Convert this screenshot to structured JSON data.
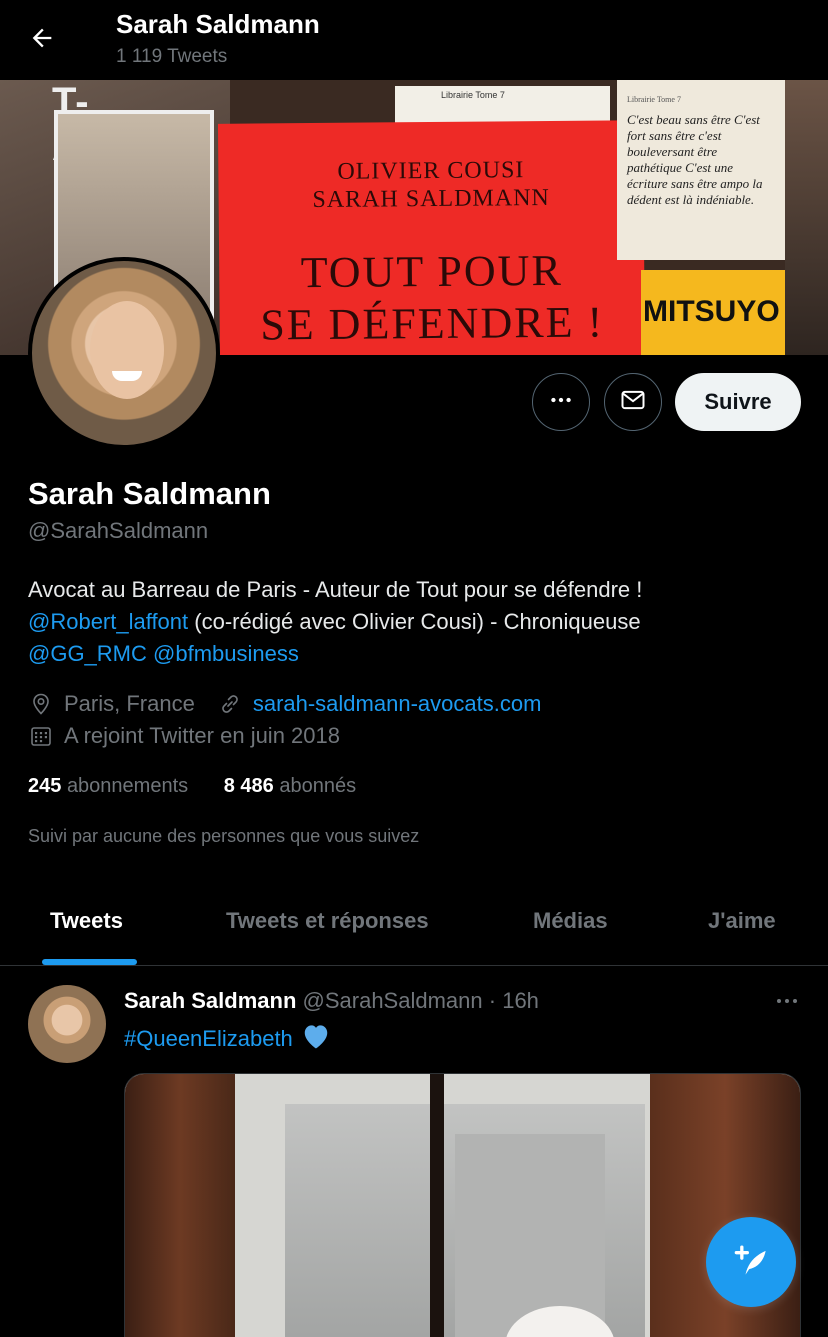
{
  "header": {
    "title": "Sarah Saldmann",
    "subtitle": "1 119 Tweets",
    "back_icon": "back-arrow-icon"
  },
  "banner": {
    "left_text": "T-ANDRÉ",
    "book_author_1": "OLIVIER COUSI",
    "book_author_2": "SARAH SALDMANN",
    "book_title_1": "TOUT POUR",
    "book_title_2": "SE DÉFENDRE !",
    "note_small": "Librairie Tome 7",
    "note_header": "Librairie Tome 7",
    "note_lines": "C'est beau sans être C'est fort sans être c'est bouleversant être pathétique C'est une écriture sans être ampo la dédent est là indéniable.",
    "yellow_label": "MITSUYO"
  },
  "actions": {
    "more_icon": "more-horizontal-icon",
    "mail_icon": "envelope-icon",
    "follow_label": "Suivre"
  },
  "profile": {
    "name": "Sarah Saldmann",
    "handle": "@SarahSaldmann",
    "bio_line1": "Avocat au Barreau de Paris - Auteur de Tout pour se défendre !",
    "bio_mention1": "@Robert_laffont",
    "bio_line2_rest": " (co-rédigé avec Olivier Cousi) - Chroniqueuse",
    "bio_mention2": "@GG_RMC",
    "bio_mention3": "@bfmbusiness",
    "location": "Paris, France",
    "website": "sarah-saldmann-avocats.com",
    "joined": "A rejoint Twitter en juin 2018",
    "following_count": "245",
    "following_label": "abonnements",
    "followers_count": "8 486",
    "followers_label": "abonnés",
    "followed_by": "Suivi par aucune des personnes que vous suivez"
  },
  "tabs": [
    {
      "label": "Tweets",
      "active": true
    },
    {
      "label": "Tweets et réponses",
      "active": false
    },
    {
      "label": "Médias",
      "active": false
    },
    {
      "label": "J'aime",
      "active": false
    }
  ],
  "tweet": {
    "name": "Sarah Saldmann",
    "handle": "@SarahSaldmann",
    "separator": "·",
    "time": "16h",
    "hashtag": "#QueenElizabeth",
    "emoji": "💙"
  },
  "colors": {
    "accent": "#1d9bf0",
    "background": "#000000",
    "secondary_text": "#71767b"
  }
}
